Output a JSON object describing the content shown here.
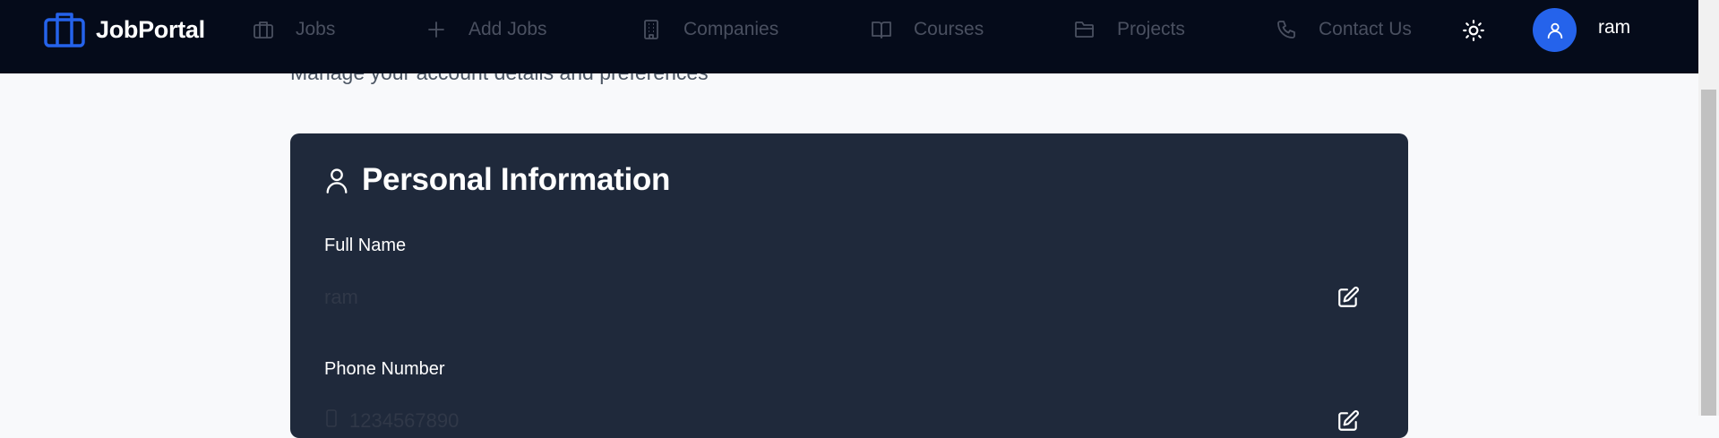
{
  "navbar": {
    "brand": "JobPortal",
    "items": [
      {
        "label": "Jobs",
        "icon": "briefcase-icon"
      },
      {
        "label": "Add Jobs",
        "icon": "plus-icon"
      },
      {
        "label": "Companies",
        "icon": "building-icon"
      },
      {
        "label": "Courses",
        "icon": "book-icon"
      },
      {
        "label": "Projects",
        "icon": "folder-icon"
      },
      {
        "label": "Contact Us",
        "icon": "phone-icon"
      }
    ],
    "theme_icon": "sun-icon",
    "username": "ram"
  },
  "page": {
    "subtitle": "Manage your account details and preferences"
  },
  "personal_info": {
    "title": "Personal Information",
    "icon": "user-icon",
    "full_name_label": "Full Name",
    "full_name_value": "ram",
    "phone_label": "Phone Number",
    "phone_value": "1234567890"
  },
  "colors": {
    "navbar_bg": "#050b1a",
    "card_bg": "#1f293b",
    "accent": "#2563eb",
    "page_bg": "#f8f9fb"
  }
}
